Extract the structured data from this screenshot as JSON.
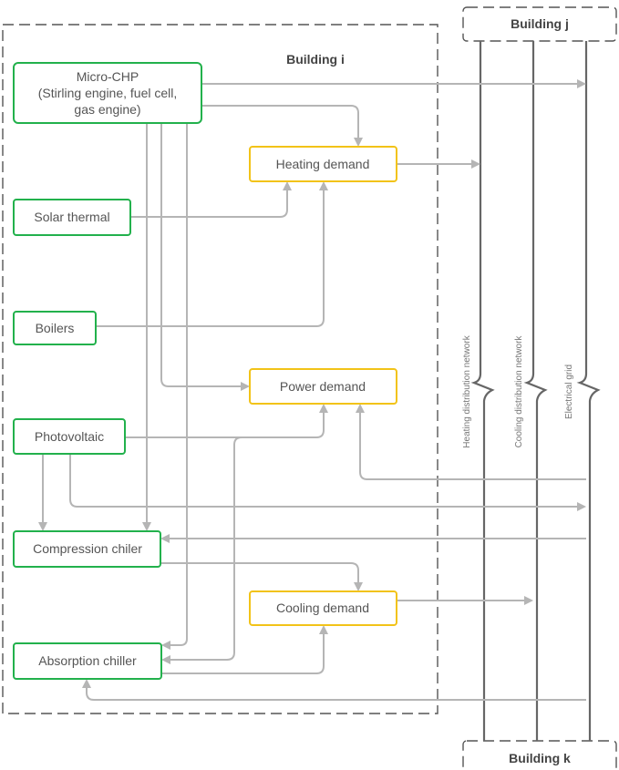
{
  "buildings": {
    "i": "Building i",
    "j": "Building j",
    "k": "Building k"
  },
  "supply": {
    "micro_chp": [
      "Micro-CHP",
      "(Stirling engine, fuel cell,",
      "gas engine)"
    ],
    "solar_thermal": "Solar thermal",
    "boilers": "Boilers",
    "photovoltaic": "Photovoltaic",
    "compression_chiller": "Compression chiler",
    "absorption_chiller": "Absorption chiller"
  },
  "demand": {
    "heating": "Heating demand",
    "power": "Power demand",
    "cooling": "Cooling demand"
  },
  "networks": {
    "heating": "Heating distribution network",
    "cooling": "Cooling distribution network",
    "electrical": "Electrical grid"
  },
  "colors": {
    "supply_border": "#22b14c",
    "demand_border": "#f2c318",
    "flow_line": "#b5b5b5",
    "network_line": "#666666"
  }
}
